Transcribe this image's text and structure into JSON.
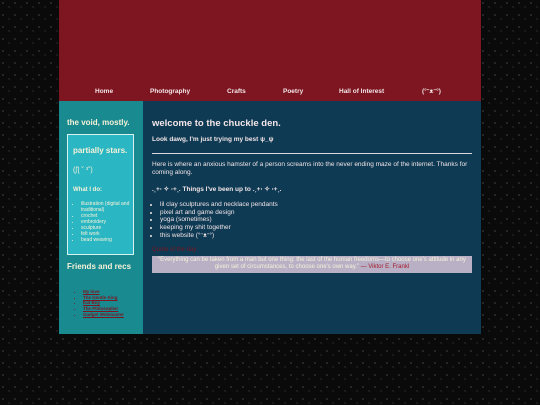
{
  "nav": {
    "items": [
      {
        "label": "Home"
      },
      {
        "label": "Photography"
      },
      {
        "label": "Crafts"
      },
      {
        "label": "Poetry"
      },
      {
        "label": "Hall of Interest"
      },
      {
        "label": "(°ᵔᴥᵔ°)"
      }
    ]
  },
  "sidebar": {
    "title": "the void, mostly.",
    "box": {
      "title": "partially stars.",
      "face": "(ʃƪ ˘ ³˘)",
      "subtitle": "What I do:",
      "items": [
        "illustration (digital and traditional)",
        "crochet",
        "embroidery",
        "sculpture",
        "felt work",
        "bead weaving"
      ]
    },
    "friends_title": "Friends and recs",
    "friends": [
      "My love",
      "The Gentle King",
      "Kat Boy",
      "The Philosopher",
      "Gadget Webmaster"
    ]
  },
  "main": {
    "title": "welcome to the chuckle den.",
    "subtitle": "Look dawg, I'm just trying my best ψ_ψ",
    "intro": "Here is where an anxious hamster of a person screams into the never ending maze of the internet. Thanks for coming along.",
    "things_heading": ".˳+⋅ ✧ ⋅+˳. Things I've been up to .˳+⋅ ✧ ⋅+˳.",
    "things": [
      "lil clay sculptures and necklace pendants",
      "pixel art and game design",
      "yoga (sometimes)",
      "keeping my shit together",
      "this website (°ᵔᴥᵔ°)"
    ],
    "quote_label": "Quote of the day",
    "quote_text": "“Everything can be taken from a man but one thing: the last of the human freedoms—to choose one's attitude in any given set of circumstances, to choose one's own way.” ",
    "quote_author": "— Viktor E. Frankl"
  },
  "colors": {
    "header": "#7d1620",
    "sidebar": "#188a90",
    "sidebar_box": "#2bb6c4",
    "main": "#0e3a54",
    "quote_box": "#b9b0c6",
    "background": "#0a0a0a"
  }
}
